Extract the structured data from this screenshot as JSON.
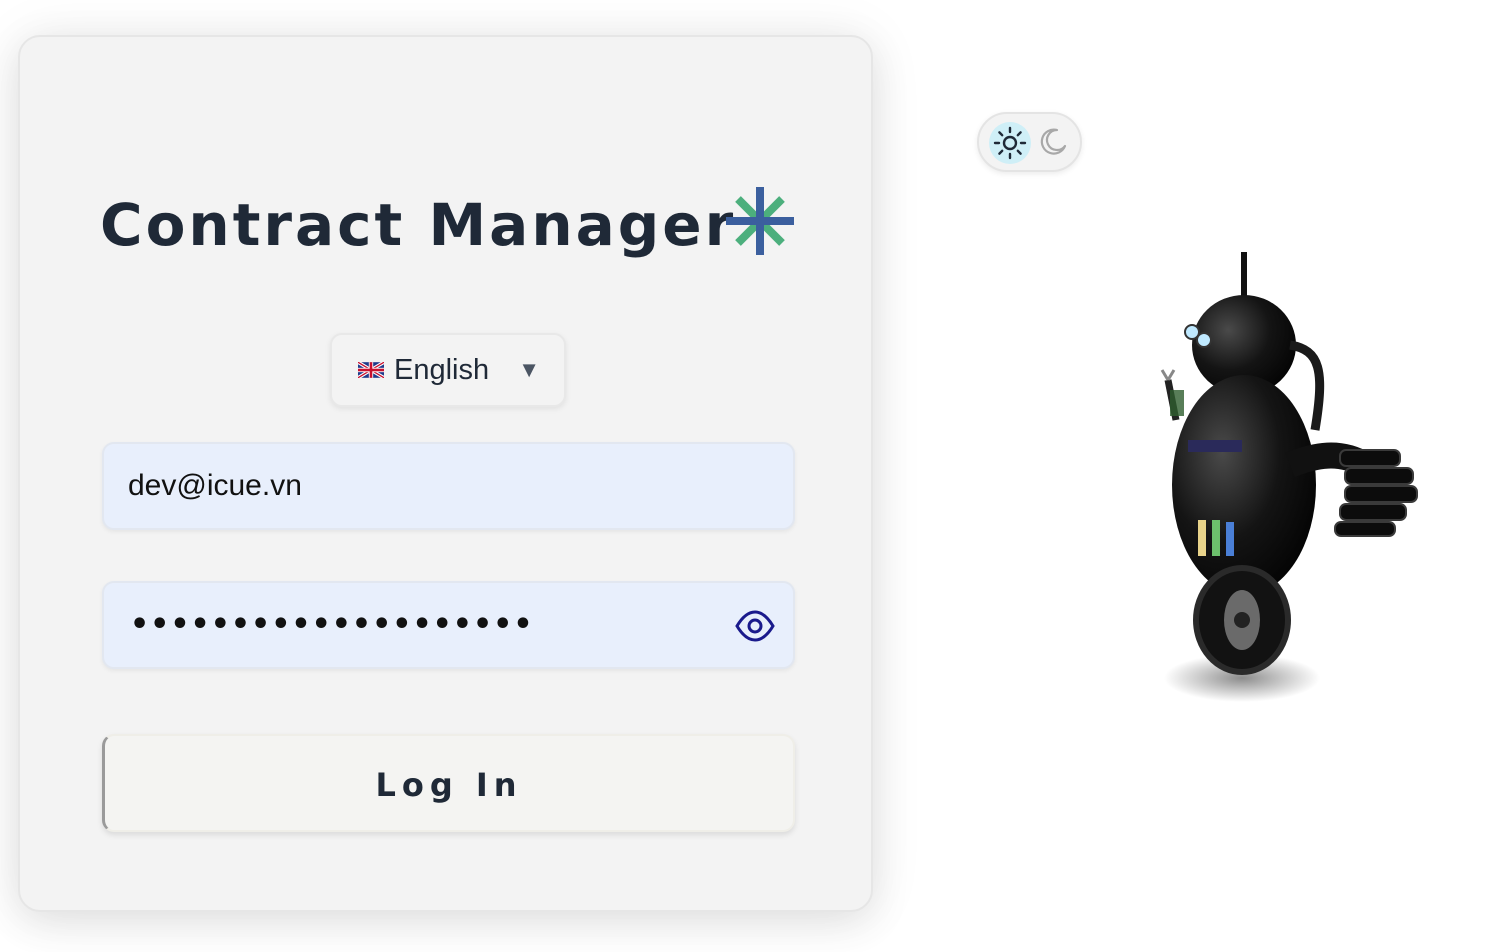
{
  "app": {
    "title": "Contract Manager"
  },
  "language": {
    "selected": "English",
    "flag": "uk-flag-icon"
  },
  "login": {
    "email_value": "dev@icue.vn",
    "password_masked": "••••••••••••••••••••",
    "button_label": "Log In"
  },
  "theme": {
    "mode": "light",
    "icons": [
      "sun-icon",
      "moon-icon"
    ]
  },
  "colors": {
    "title": "#1f2937",
    "input_bg": "#e8effc",
    "eye_icon": "#1a1a8c",
    "theme_active_bg": "#cfeff7",
    "logo_green": "#4caf7d",
    "logo_blue": "#3b5f9e"
  }
}
